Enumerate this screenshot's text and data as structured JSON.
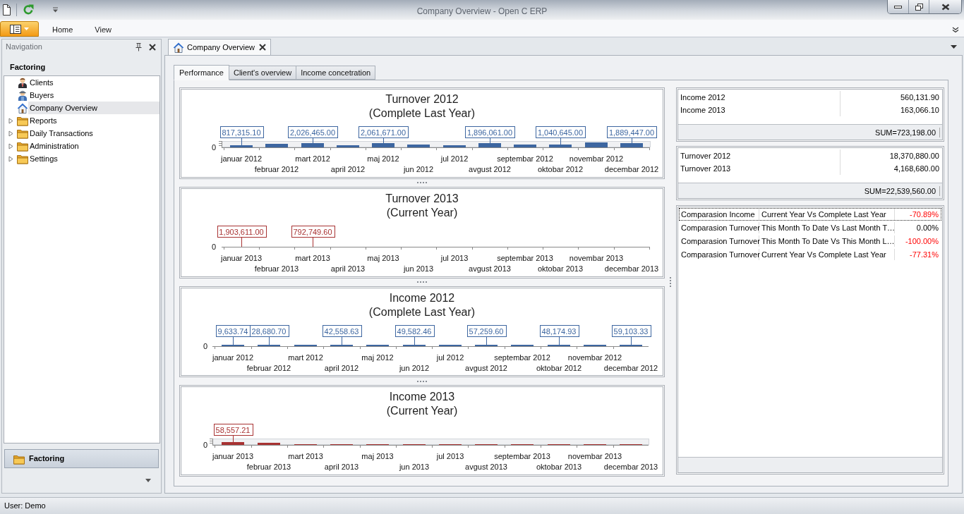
{
  "window": {
    "title": "Company Overview - Open C ERP"
  },
  "ribbon": {
    "tabs": [
      {
        "label": "Home",
        "selected": false
      },
      {
        "label": "View",
        "selected": false
      }
    ]
  },
  "navigation": {
    "title": "Navigation",
    "group_title": "Factoring",
    "items": [
      {
        "label": "Clients",
        "kind": "client",
        "selected": false
      },
      {
        "label": "Buyers",
        "kind": "buyer",
        "selected": false
      },
      {
        "label": "Company Overview",
        "kind": "overview",
        "selected": true
      },
      {
        "label": "Reports",
        "kind": "folder",
        "expanded": false,
        "selected": false
      },
      {
        "label": "Daily Transactions",
        "kind": "folder",
        "expanded": false,
        "selected": false
      },
      {
        "label": "Administration",
        "kind": "folder",
        "expanded": false,
        "selected": false
      },
      {
        "label": "Settings",
        "kind": "folder",
        "expanded": false,
        "selected": false
      }
    ],
    "group_buttons": [
      {
        "label": "Factoring",
        "selected": true
      }
    ]
  },
  "document_tabs": [
    {
      "label": "Company Overview",
      "selected": true
    }
  ],
  "page_tabs": [
    {
      "label": "Performance",
      "selected": true
    },
    {
      "label": "Client's overview",
      "selected": false
    },
    {
      "label": "Income concetration",
      "selected": false
    }
  ],
  "charts": [
    {
      "title": "Turnover 2012",
      "subtitle": "(Complete Last Year)",
      "color": "#3d66a0",
      "axis_label": "0",
      "months": [
        {
          "label": "januar 2012",
          "value_label": "817,315.10"
        },
        {
          "label": "februar 2012"
        },
        {
          "label": "mart 2012",
          "value_label": "2,026,465.00"
        },
        {
          "label": "april 2012"
        },
        {
          "label": "maj 2012",
          "value_label": "2,061,671.00"
        },
        {
          "label": "jun 2012"
        },
        {
          "label": "jul 2012"
        },
        {
          "label": "avgust 2012",
          "value_label": "1,896,061.00"
        },
        {
          "label": "septembar 2012"
        },
        {
          "label": "oktobar 2012",
          "value_label": "1,040,645.00"
        },
        {
          "label": "novembar 2012"
        },
        {
          "label": "decembar 2012",
          "value_label": "1,889,447.00"
        }
      ]
    },
    {
      "title": "Turnover 2013",
      "subtitle": "(Current Year)",
      "color": "#a83232",
      "axis_label": "0",
      "months": [
        {
          "label": "januar 2013",
          "value_label": "1,903,611.00"
        },
        {
          "label": "februar 2013"
        },
        {
          "label": "mart 2013",
          "value_label": "792,749.60"
        },
        {
          "label": "april 2013"
        },
        {
          "label": "maj 2013"
        },
        {
          "label": "jun 2013"
        },
        {
          "label": "jul 2013"
        },
        {
          "label": "avgust 2013"
        },
        {
          "label": "septembar 2013"
        },
        {
          "label": "oktobar 2013"
        },
        {
          "label": "novembar 2013"
        },
        {
          "label": "decembar 2013"
        }
      ]
    },
    {
      "title": "Income 2012",
      "subtitle": "(Complete Last Year)",
      "color": "#3d66a0",
      "axis_label": "0",
      "months": [
        {
          "label": "januar 2012",
          "value_label": "9,633.74"
        },
        {
          "label": "februar 2012",
          "value_label": "28,680.70"
        },
        {
          "label": "mart 2012"
        },
        {
          "label": "april 2012",
          "value_label": "42,558.63"
        },
        {
          "label": "maj 2012"
        },
        {
          "label": "jun 2012",
          "value_label": "49,582.46"
        },
        {
          "label": "jul 2012"
        },
        {
          "label": "avgust 2012",
          "value_label": "57,259.60"
        },
        {
          "label": "septembar 2012"
        },
        {
          "label": "oktobar 2012",
          "value_label": "48,174.93"
        },
        {
          "label": "novembar 2012"
        },
        {
          "label": "decembar 2012",
          "value_label": "59,103.33"
        }
      ]
    },
    {
      "title": "Income 2013",
      "subtitle": "(Current Year)",
      "color": "#a83232",
      "axis_label": "0",
      "months": [
        {
          "label": "januar 2013",
          "value_label": "58,557.21"
        },
        {
          "label": "februar 2013"
        },
        {
          "label": "mart 2013"
        },
        {
          "label": "april 2013"
        },
        {
          "label": "maj 2013"
        },
        {
          "label": "jun 2013"
        },
        {
          "label": "jul 2013"
        },
        {
          "label": "avgust 2013"
        },
        {
          "label": "septembar 2013"
        },
        {
          "label": "oktobar 2013"
        },
        {
          "label": "novembar 2013"
        },
        {
          "label": "decembar 2013"
        }
      ]
    }
  ],
  "summary_tables": [
    {
      "rows": [
        {
          "label": "Income 2012",
          "value": "560,131.90"
        },
        {
          "label": "Income 2013",
          "value": "163,066.10"
        }
      ],
      "total": "SUM=723,198.00"
    },
    {
      "rows": [
        {
          "label": "Turnover 2012",
          "value": "18,370,880.00"
        },
        {
          "label": "Turnover 2013",
          "value": "4,168,680.00"
        }
      ],
      "total": "SUM=22,539,560.00"
    }
  ],
  "comparison_table": {
    "rows": [
      {
        "metric": "Comparasion Income",
        "period": "Current Year Vs Complete Last Year",
        "change": "-70.89%",
        "negative": true,
        "selected": true
      },
      {
        "metric": "Comparasion Turnover",
        "period": "This Month To Date Vs Last Month T…",
        "change": "0.00%",
        "negative": false,
        "selected": false
      },
      {
        "metric": "Comparasion Turnover",
        "period": "This Month To Date Vs This Month L…",
        "change": "-100.00%",
        "negative": true,
        "selected": false
      },
      {
        "metric": "Comparasion Turnover",
        "period": "Current Year Vs Complete Last Year",
        "change": "-77.31%",
        "negative": true,
        "selected": false
      }
    ]
  },
  "status_bar": {
    "text": "User: Demo"
  }
}
